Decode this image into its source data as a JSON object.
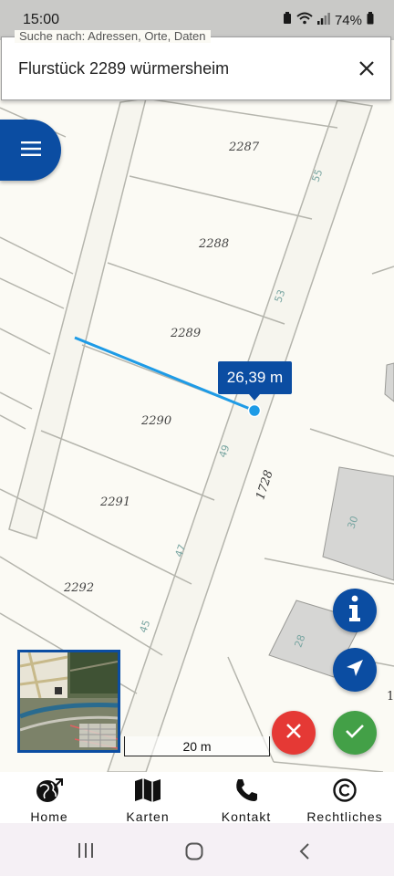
{
  "status_bar": {
    "time": "15:00",
    "battery": "74%"
  },
  "search": {
    "legend": "Suche nach: Adressen, Orte, Daten",
    "value": "Flurstück 2289 würmersheim"
  },
  "map": {
    "parcels": [
      "2287",
      "2288",
      "2289",
      "2290",
      "2291",
      "2292"
    ],
    "house_numbers": [
      "55",
      "53",
      "49",
      "47",
      "45",
      "30",
      "28"
    ],
    "street_number": "1728",
    "partial_label": "1"
  },
  "measurement": {
    "distance_label": "26,39 m"
  },
  "scale": {
    "label": "20 m"
  },
  "bottom_nav": [
    {
      "label": "Home",
      "icon": "globe-icon"
    },
    {
      "label": "Karten",
      "icon": "map-icon"
    },
    {
      "label": "Kontakt",
      "icon": "phone-icon"
    },
    {
      "label": "Rechtliches",
      "icon": "copyright-icon"
    }
  ],
  "colors": {
    "primary": "#0b4da2",
    "measure_line": "#1e9be6",
    "cancel": "#e53935",
    "confirm": "#43a047"
  }
}
